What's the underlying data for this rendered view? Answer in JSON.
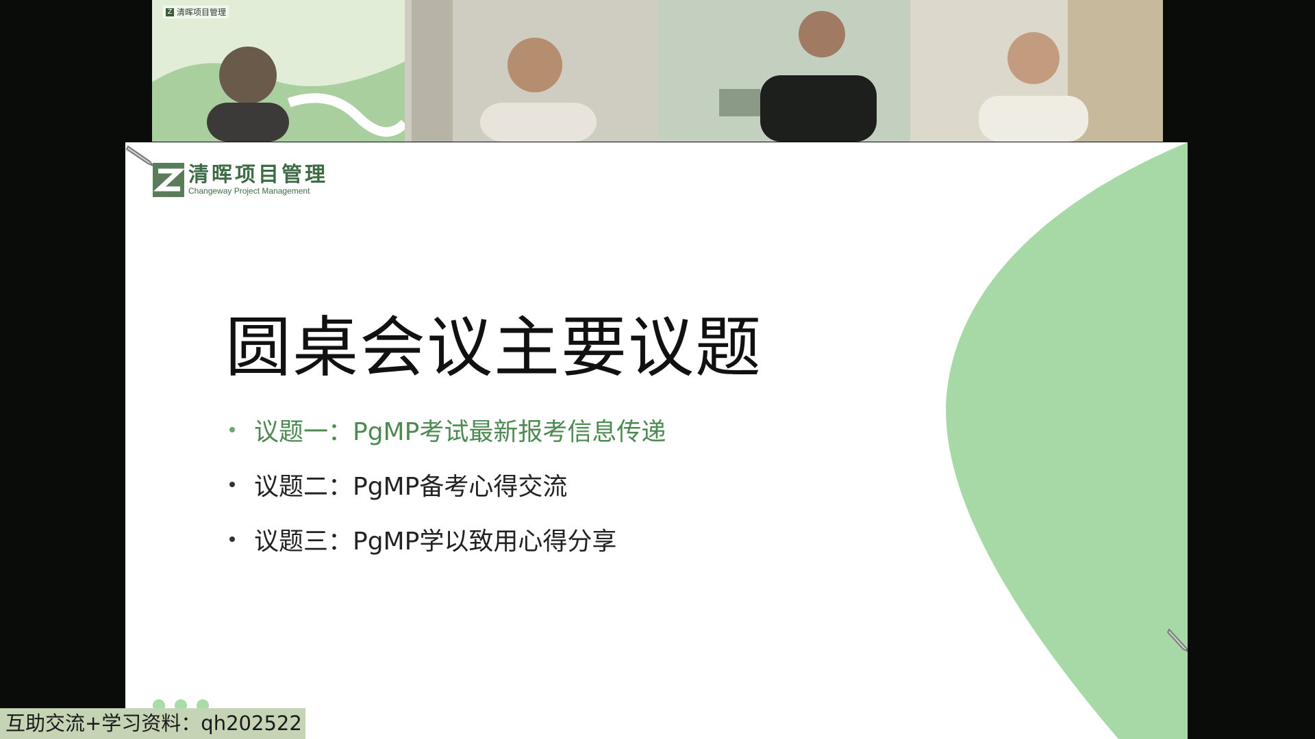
{
  "participants": [
    {
      "tile_logo_text": "清晖项目管理",
      "background": "#d9e8cf"
    },
    {
      "background": "#c9c6bc"
    },
    {
      "background": "#b9c7b6"
    },
    {
      "background": "#d5d1c4"
    }
  ],
  "slide": {
    "brand_cn": "清晖项目管理",
    "brand_en": "Changeway Project Management",
    "title": "圆桌会议主要议题",
    "agenda": [
      {
        "label": "议题一：PgMP考试最新报考信息传递",
        "active": true
      },
      {
        "label": "议题二：PgMP备考心得交流",
        "active": false
      },
      {
        "label": "议题三：PgMP学以致用心得分享",
        "active": false
      }
    ],
    "accent_color": "#a6d9a6",
    "active_color": "#4c8a52"
  },
  "watermark": "互助交流+学习资料：qh202522",
  "icons": [
    "logo-mark-icon",
    "pen-icon",
    "person-icon"
  ]
}
